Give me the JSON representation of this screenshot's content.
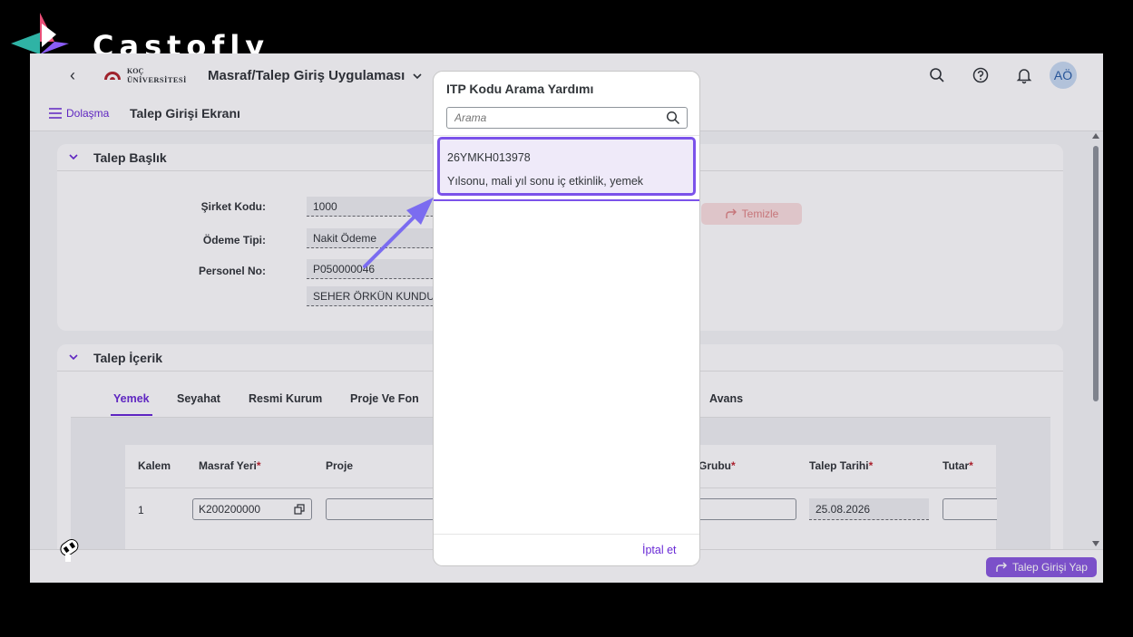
{
  "brand": {
    "name": "Castofly"
  },
  "shell": {
    "back_glyph": "‹",
    "logo_line1": "KOÇ",
    "logo_line2": "ÜNİVERSİTESİ",
    "app_title": "Masraf/Talep Giriş Uygulaması",
    "avatar": "AÖ",
    "icons": [
      "search-icon",
      "help-icon",
      "bell-icon"
    ]
  },
  "subheader": {
    "nav_label": "Dolaşma",
    "title": "Talep Girişi Ekranı"
  },
  "header_panel": {
    "title": "Talep Başlık",
    "fields": {
      "company_label": "Şirket Kodu:",
      "company_value": "1000",
      "payment_label": "Ödeme Tipi:",
      "payment_value": "Nakit Ödeme",
      "personnel_label": "Personel No:",
      "personnel_value": "P050000046",
      "personnel_name": "SEHER ÖRKÜN KUNDURACIOĞLU"
    },
    "clear_button": "Temizle"
  },
  "content_panel": {
    "title": "Talep İçerik",
    "tabs": [
      "Yemek",
      "Seyahat",
      "Resmi Kurum",
      "Proje Ve Fon",
      "Avans"
    ],
    "active_tab": "Yemek",
    "columns": {
      "kalem": "Kalem",
      "masraf_yeri": "Masraf Yeri",
      "proje": "Proje",
      "grubu": "Grubu",
      "talep_tarihi": "Talep Tarihi",
      "tutar": "Tutar",
      "required_mark": "*"
    },
    "row": {
      "kalem": "1",
      "masraf_yeri": "K200200000",
      "talep_tarihi": "25.08.2026"
    }
  },
  "footer": {
    "submit_label": "Talep Girişi Yap"
  },
  "dialog": {
    "title": "ITP Kodu Arama Yardımı",
    "search_placeholder": "Arama",
    "items": [
      {
        "code": "26YMKH013978",
        "description": "Yılsonu, mali yıl sonu iç etkinlik, yemek"
      }
    ],
    "cancel_label": "İptal et"
  },
  "colors": {
    "accent": "#6a2bd6",
    "highlight": "#7b52ea",
    "submit": "#8a5be0"
  }
}
